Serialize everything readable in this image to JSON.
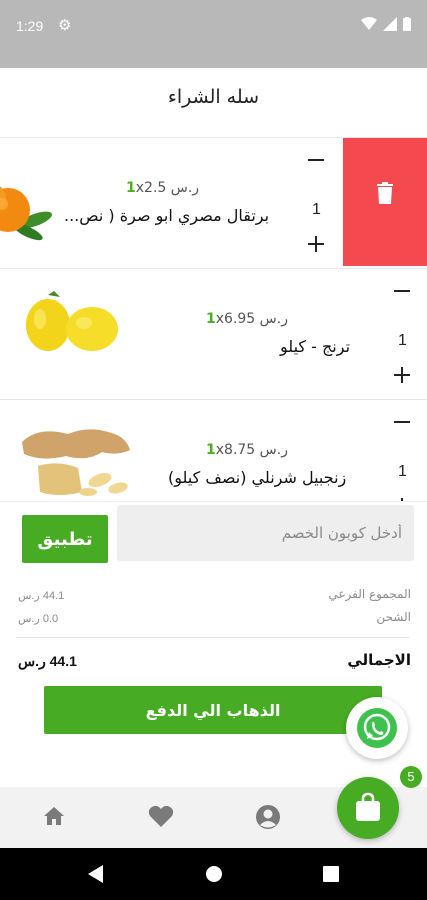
{
  "status_bar": {
    "time": "1:29"
  },
  "header": {
    "title": "سله الشراء"
  },
  "cart": {
    "items": [
      {
        "name": "برتقال مصري ابو صرة ( نص...",
        "price": "ر.س 2.5",
        "qty_prefix": "1",
        "qty_sep": "x",
        "quantity": "1",
        "image": "orange-image"
      },
      {
        "name": "ترنج - كيلو",
        "price": "ر.س 6.95",
        "qty_prefix": "1",
        "qty_sep": "x",
        "quantity": "1",
        "image": "citron-image"
      },
      {
        "name": "زنجبيل شرنلي (نصف كيلو)",
        "price": "ر.س 8.75",
        "qty_prefix": "1",
        "qty_sep": "x",
        "quantity": "1",
        "image": "ginger-image"
      }
    ],
    "delete_icon": "trash-icon",
    "delete_color": "#f44a4f"
  },
  "coupon": {
    "placeholder": "أدخل كوبون الخصم",
    "apply_label": "تطبيق"
  },
  "totals": {
    "subtotal_label": "المجموع الفرعي",
    "subtotal_value": "44.1 ر.س",
    "shipping_label": "الشحن",
    "shipping_value": "0.0 ر.س",
    "total_label": "الاجمالي",
    "total_value": "44.1 ر.س"
  },
  "checkout": {
    "label": "الذهاب الي الدفع"
  },
  "nav": {
    "items": [
      "home-icon",
      "heart-icon",
      "account-icon"
    ],
    "cart_badge": "5"
  },
  "colors": {
    "accent": "#47ac23",
    "delete": "#f44a4f"
  }
}
